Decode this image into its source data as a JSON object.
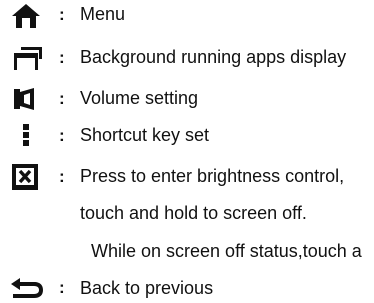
{
  "legend": {
    "separator": ":",
    "items": [
      {
        "icon": "home-icon",
        "label": "Menu"
      },
      {
        "icon": "recent-apps-icon",
        "label": "Background running apps display"
      },
      {
        "icon": "speaker-icon",
        "label": "Volume setting"
      },
      {
        "icon": "vertical-dots-icon",
        "label": "Shortcut key set"
      },
      {
        "icon": "brightness-box-icon",
        "label": "Press to enter brightness control,",
        "continuation": [
          "touch and hold to screen off.",
          "While on screen off status,touch a"
        ]
      },
      {
        "icon": "back-arrow-icon",
        "label": "Back to previous"
      }
    ]
  }
}
